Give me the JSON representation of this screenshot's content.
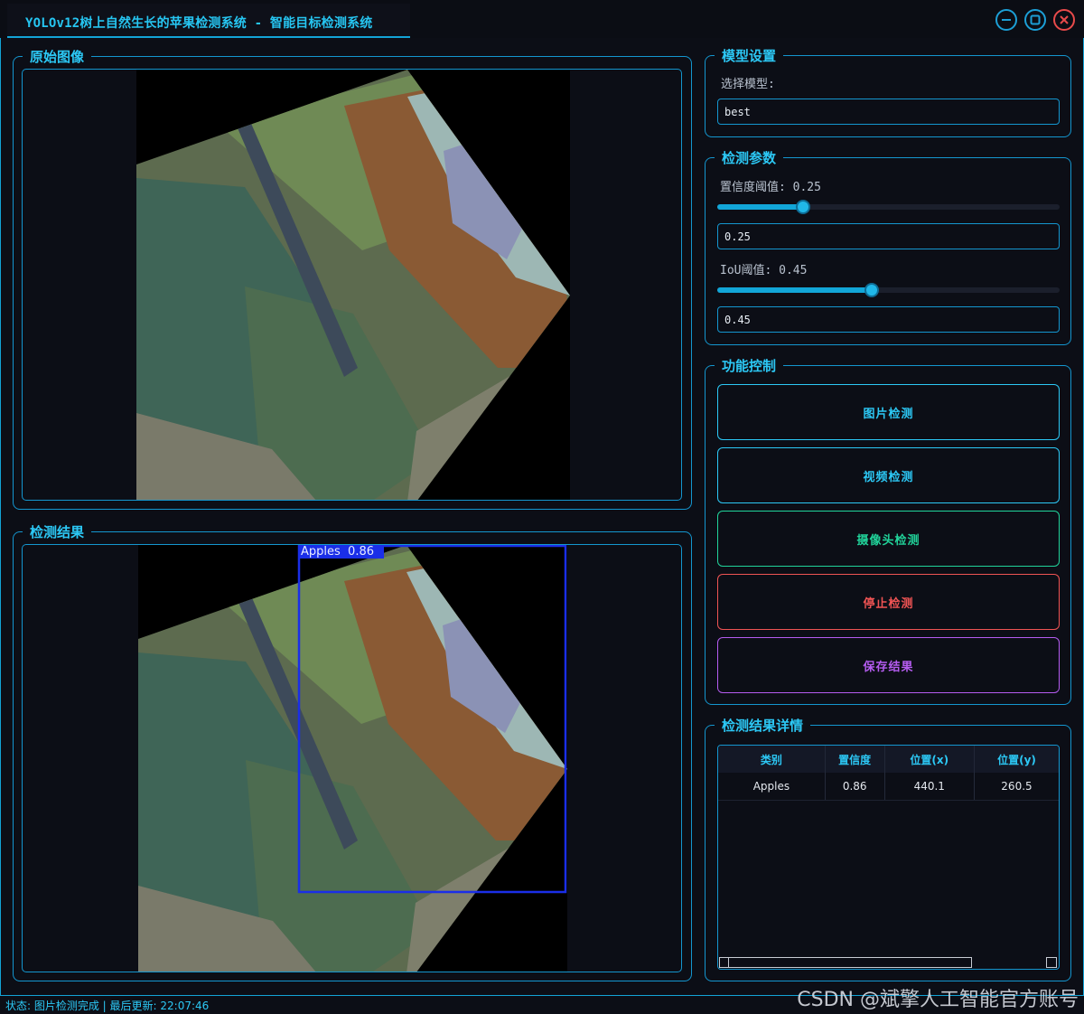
{
  "window": {
    "title": "YOLOv12树上自然生长的苹果检测系统 - 智能目标检测系统"
  },
  "panels": {
    "original": {
      "title": "原始图像"
    },
    "result": {
      "title": "检测结果"
    },
    "model": {
      "title": "模型设置",
      "select_label": "选择模型:",
      "select_value": "best"
    },
    "params": {
      "title": "检测参数",
      "conf_label": "置信度阈值: 0.25",
      "conf_value": "0.25",
      "conf_level": 0.25,
      "iou_label": "IoU阈值: 0.45",
      "iou_value": "0.45",
      "iou_level": 0.45
    },
    "control": {
      "title": "功能控制",
      "buttons": [
        {
          "label": "图片检测",
          "color": "#2cc8f5"
        },
        {
          "label": "视频检测",
          "color": "#2cc8f5"
        },
        {
          "label": "摄像头检测",
          "color": "#21d39a"
        },
        {
          "label": "停止检测",
          "color": "#f05454"
        },
        {
          "label": "保存结果",
          "color": "#b55cf0"
        }
      ]
    },
    "details": {
      "title": "检测结果详情",
      "headers": [
        "类别",
        "置信度",
        "位置(x)",
        "位置(y)"
      ],
      "rows": [
        [
          "Apples",
          "0.86",
          "440.1",
          "260.5"
        ]
      ]
    }
  },
  "detection": {
    "label": "Apples  0.86",
    "box_color": "#1a2ee8"
  },
  "status": {
    "text": "状态: 图片检测完成 | 最后更新: 22:07:46"
  },
  "watermark": "CSDN @斌擎人工智能官方账号"
}
